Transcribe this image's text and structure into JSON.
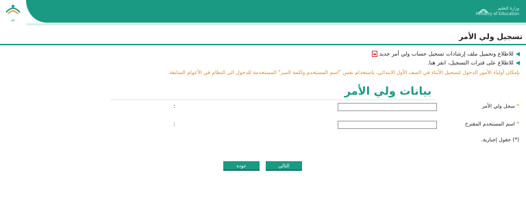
{
  "header": {
    "ministry_text": "وزارة التعليم",
    "ministry_subtext": "Ministry of Education",
    "noor_caption": "نور"
  },
  "page_title": "تسجيل ولي الأمر",
  "links": [
    {
      "text": "للاطلاع وتحميل ملف إرشادات تسجيل حساب ولي أمر جديد"
    },
    {
      "text": "للاطلاع على فترات التسجيل،",
      "link": "انقر هنا."
    }
  ],
  "notice": "بإمكان أولياء الأمور الدخول لتسجيل الأبناء في الصف الأول الابتدائي، باستخدام نفس \"اسم المستخدم وكلمة السر\" المستخدمة للدخول الى النظام في الأعوام السابقة.",
  "form": {
    "section_title": "بيانات ولي الأمر",
    "fields": [
      {
        "label": "سجل ولي الأمر",
        "value": ""
      },
      {
        "label": "اسم المستخدم المقترح",
        "value": ""
      }
    ],
    "required_star": "*",
    "colon": ":",
    "required_note": "(*) حقول إجبارية."
  },
  "buttons": {
    "next": "التالي",
    "back": "عودة"
  },
  "colors": {
    "accent": "#1a9a83",
    "notice": "#d98a2a"
  }
}
